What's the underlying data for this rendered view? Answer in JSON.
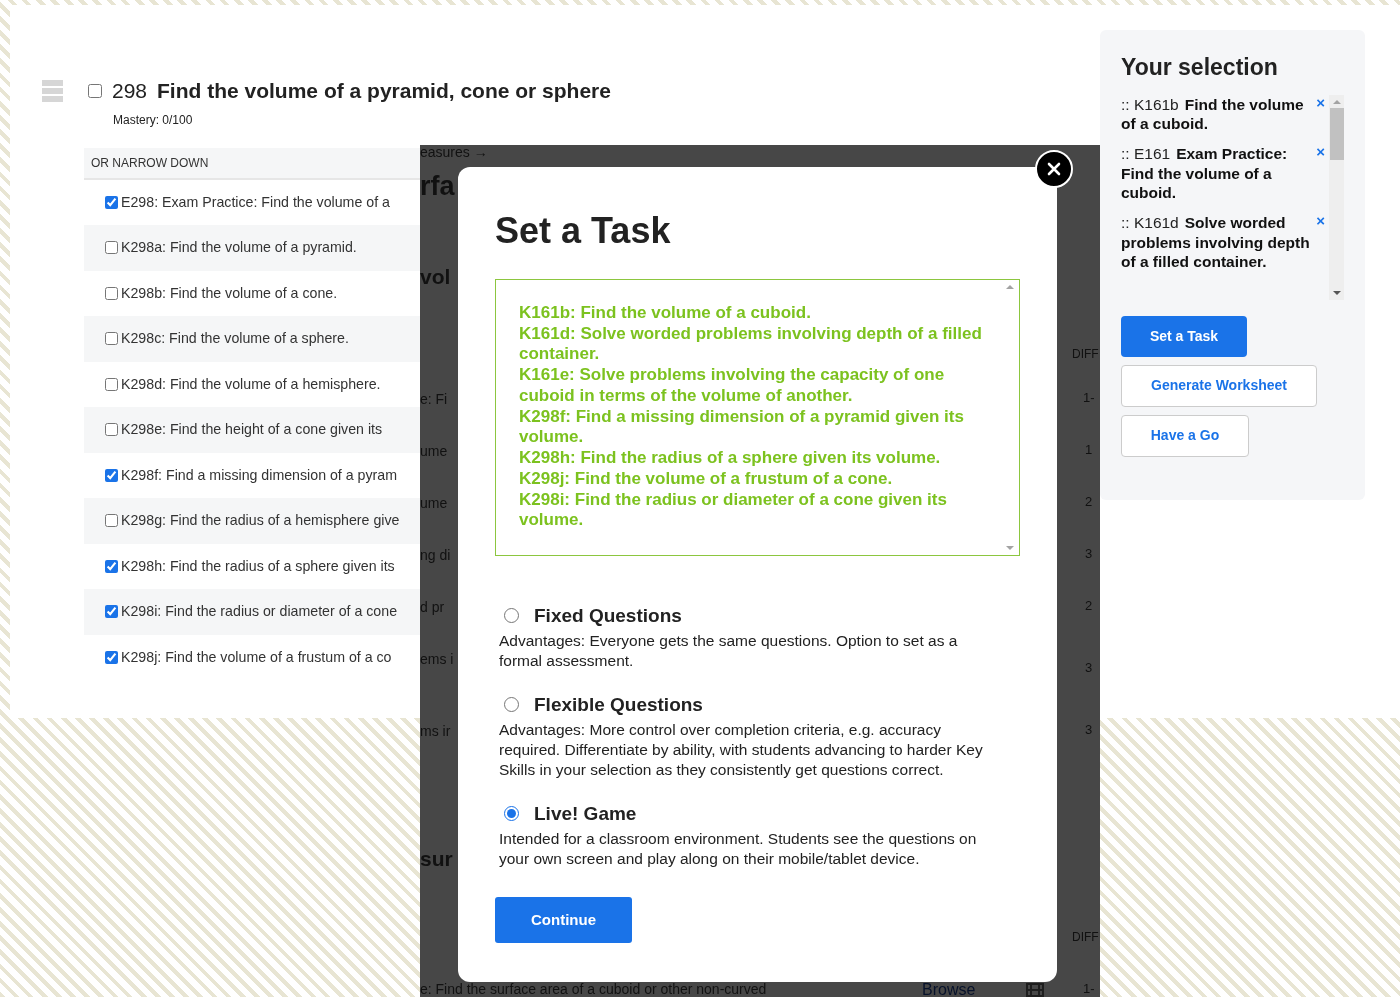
{
  "topic": {
    "number": "298",
    "title": "Find the volume of a pyramid, cone or sphere",
    "checked": false,
    "mastery": "Mastery: 0/100"
  },
  "narrow_down": {
    "heading": "OR NARROW DOWN",
    "items": [
      {
        "label": "E298: Exam Practice: Find the volume of a",
        "checked": true
      },
      {
        "label": "K298a: Find the volume of a pyramid.",
        "checked": false
      },
      {
        "label": "K298b: Find the volume of a cone.",
        "checked": false
      },
      {
        "label": "K298c: Find the volume of a sphere.",
        "checked": false
      },
      {
        "label": "K298d: Find the volume of a hemisphere.",
        "checked": false
      },
      {
        "label": "K298e: Find the height of a cone given its",
        "checked": false
      },
      {
        "label": "K298f: Find a missing dimension of a pyram",
        "checked": true
      },
      {
        "label": "K298g: Find the radius of a hemisphere give",
        "checked": false
      },
      {
        "label": "K298h: Find the radius of a sphere given its",
        "checked": true
      },
      {
        "label": "K298i: Find the radius or diameter of a cone",
        "checked": true
      },
      {
        "label": "K298j: Find the volume of a frustum of a co",
        "checked": true
      }
    ]
  },
  "background_page": {
    "fragments": [
      {
        "kind": "link",
        "text": "easures →"
      },
      {
        "kind": "heading",
        "text": "rfa"
      },
      {
        "kind": "subheading",
        "text": "vol"
      },
      {
        "kind": "text",
        "text": "e: Fi"
      },
      {
        "kind": "text",
        "text": "ume"
      },
      {
        "kind": "text",
        "text": "ume"
      },
      {
        "kind": "text",
        "text": "ng di"
      },
      {
        "kind": "text",
        "text": "d pr"
      },
      {
        "kind": "text",
        "text": "ems i"
      },
      {
        "kind": "text",
        "text": "ms ir"
      },
      {
        "kind": "subheading",
        "text": "sur"
      },
      {
        "kind": "text",
        "text": "e: Find the surface area of a cuboid or other non-curved"
      },
      {
        "kind": "column-header",
        "text": "DIFF"
      },
      {
        "kind": "number",
        "text": "1-"
      },
      {
        "kind": "number",
        "text": "1"
      },
      {
        "kind": "number",
        "text": "2"
      },
      {
        "kind": "number",
        "text": "3"
      },
      {
        "kind": "number",
        "text": "2"
      },
      {
        "kind": "number",
        "text": "3"
      },
      {
        "kind": "number",
        "text": "3"
      },
      {
        "kind": "column-header",
        "text": "DIFF"
      },
      {
        "kind": "link",
        "text": "Browse"
      },
      {
        "kind": "video"
      },
      {
        "kind": "number",
        "text": "1-"
      }
    ]
  },
  "modal": {
    "title": "Set a Task",
    "selected_skills": [
      "K161b: Find the volume of a cuboid.",
      "K161d: Solve worded problems involving depth of a filled container.",
      "K161e: Solve problems involving the capacity of one cuboid in terms of the volume of another.",
      "K298f: Find a missing dimension of a pyramid given its volume.",
      "K298h: Find the radius of a sphere given its volume.",
      "K298j: Find the volume of a frustum of a cone.",
      "K298i: Find the radius or diameter of a cone given its volume."
    ],
    "options": [
      {
        "label": "Fixed Questions",
        "description": "Advantages: Everyone gets the same questions. Option to set as a formal assessment.",
        "selected": false
      },
      {
        "label": "Flexible Questions",
        "description": "Advantages: More control over completion criteria, e.g. accuracy required. Differentiate by ability, with students advancing to harder Key Skills in your selection as they consistently get questions correct.",
        "selected": false
      },
      {
        "label": "Live! Game",
        "description": "Intended for a classroom environment. Students see the questions on your own screen and play along on their mobile/tablet device.",
        "selected": true
      }
    ],
    "continue_button": "Continue"
  },
  "selection_panel": {
    "title": "Your selection",
    "items": [
      {
        "code": ":: K161b",
        "title": "Find the volume of a cuboid.",
        "remove": "×"
      },
      {
        "code": ":: E161",
        "title": "Exam Practice: Find the volume of a cuboid.",
        "remove": "×"
      },
      {
        "code": ":: K161d",
        "title": "Solve worded problems involving depth of a filled container.",
        "remove": "×"
      }
    ],
    "buttons": [
      {
        "label": "Set a Task",
        "kind": "primary"
      },
      {
        "label": "Generate Worksheet",
        "kind": "outline"
      },
      {
        "label": "Have a Go",
        "kind": "outline"
      }
    ]
  }
}
